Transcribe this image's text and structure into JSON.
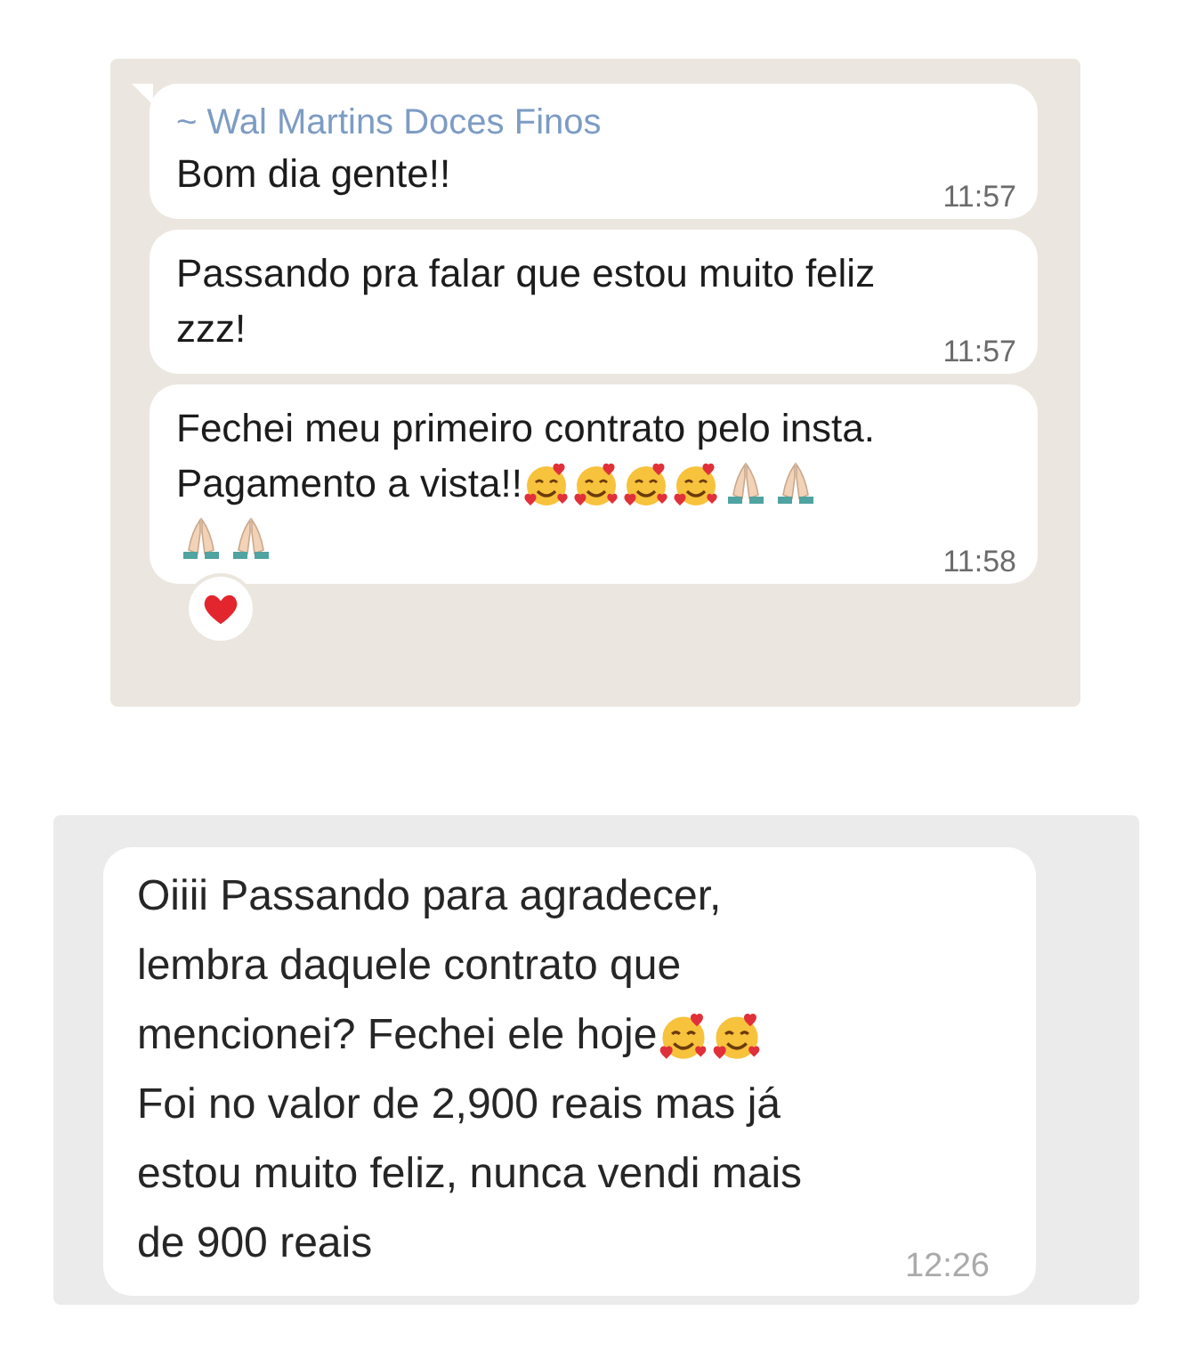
{
  "panels": [
    {
      "kind": "group",
      "messages": [
        {
          "sender": "~ Wal Martins Doces Finos",
          "lines": [
            {
              "text": "Bom dia gente!!"
            }
          ],
          "time": "11:57"
        },
        {
          "lines": [
            {
              "text": "Passando pra falar que estou muito feliz"
            },
            {
              "text": "zzz!"
            }
          ],
          "time": "11:57"
        },
        {
          "lines": [
            {
              "text": "Fechei meu primeiro contrato pelo insta."
            },
            {
              "text": "Pagamento a vista!!",
              "emojis": [
                {
                  "kind": "hearts-face"
                },
                {
                  "kind": "hearts-face"
                },
                {
                  "kind": "hearts-face"
                },
                {
                  "kind": "hearts-face"
                },
                {
                  "kind": "praying-hands"
                },
                {
                  "kind": "praying-hands"
                }
              ]
            },
            {
              "emojis": [
                {
                  "kind": "praying-hands"
                },
                {
                  "kind": "praying-hands"
                }
              ]
            }
          ],
          "time": "11:58",
          "reactions": [
            {
              "kind": "heart"
            }
          ]
        }
      ]
    },
    {
      "kind": "direct",
      "messages": [
        {
          "lines": [
            {
              "text": "Oiiii Passando para agradecer,"
            },
            {
              "text": "lembra daquele contrato que"
            },
            {
              "text": "mencionei? Fechei ele hoje",
              "emojis": [
                {
                  "kind": "hearts-face"
                },
                {
                  "kind": "hearts-face"
                }
              ]
            },
            {
              "text": "Foi no valor de 2,900 reais mas já"
            },
            {
              "text": "estou muito feliz, nunca vendi mais"
            },
            {
              "text": "de 900 reais"
            }
          ],
          "time": "12:26"
        }
      ]
    }
  ]
}
